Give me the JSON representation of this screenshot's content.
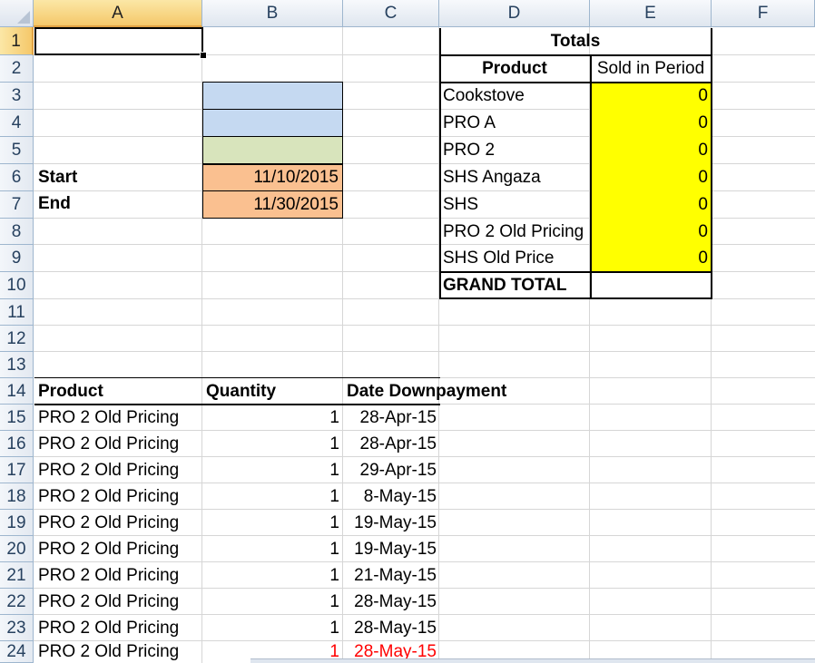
{
  "columns": [
    "A",
    "B",
    "C",
    "D",
    "E",
    "F"
  ],
  "rows": [
    "1",
    "2",
    "3",
    "4",
    "5",
    "6",
    "7",
    "8",
    "9",
    "10",
    "11",
    "12",
    "13",
    "14",
    "15",
    "16",
    "17",
    "18",
    "19",
    "20",
    "21",
    "22",
    "23",
    "24"
  ],
  "params": {
    "start_label": "Start",
    "start_value": "11/10/2015",
    "end_label": "End",
    "end_value": "11/30/2015"
  },
  "totals": {
    "title": "Totals",
    "product_header": "Product",
    "sold_header": "Sold in Period",
    "items": [
      {
        "product": "Cookstove",
        "sold": "0"
      },
      {
        "product": "PRO A",
        "sold": "0"
      },
      {
        "product": "PRO 2",
        "sold": "0"
      },
      {
        "product": "SHS Angaza",
        "sold": "0"
      },
      {
        "product": "SHS",
        "sold": "0"
      },
      {
        "product": "PRO 2 Old Pricing",
        "sold": "0"
      },
      {
        "product": "SHS Old Price",
        "sold": "0"
      }
    ],
    "grand_total_label": "GRAND TOTAL",
    "grand_total_value": ""
  },
  "table": {
    "headers": [
      "Product",
      "Quantity",
      "Date Downpayment"
    ],
    "rows": [
      [
        "PRO 2 Old Pricing",
        "1",
        "28-Apr-15"
      ],
      [
        "PRO 2 Old Pricing",
        "1",
        "28-Apr-15"
      ],
      [
        "PRO 2 Old Pricing",
        "1",
        "29-Apr-15"
      ],
      [
        "PRO 2 Old Pricing",
        "1",
        "8-May-15"
      ],
      [
        "PRO 2 Old Pricing",
        "1",
        "19-May-15"
      ],
      [
        "PRO 2 Old Pricing",
        "1",
        "19-May-15"
      ],
      [
        "PRO 2 Old Pricing",
        "1",
        "21-May-15"
      ],
      [
        "PRO 2 Old Pricing",
        "1",
        "28-May-15"
      ],
      [
        "PRO 2 Old Pricing",
        "1",
        "28-May-15"
      ],
      [
        "PRO 2 Old Pricing",
        "1",
        "28-May-15"
      ]
    ]
  },
  "colors": {
    "blue_fill": "#c5d9f1",
    "green_fill": "#d8e4bc",
    "orange_fill": "#fac090",
    "yellow_fill": "#ffff00",
    "last_row_text": "#ff0000"
  }
}
